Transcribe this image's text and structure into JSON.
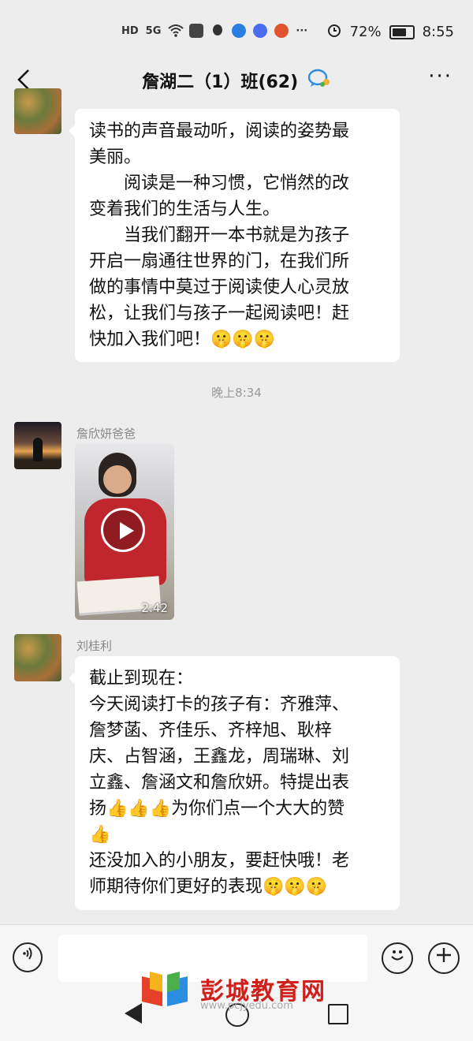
{
  "status_bar": {
    "left_icons": [
      "hd-icon",
      "signal-5g-icon",
      "wifi-icon",
      "app-icon",
      "qq-icon",
      "browser-icon",
      "music-icon",
      "news-icon",
      "more-dots-icon"
    ],
    "hd": "HD",
    "net": "5G",
    "overflow": "···",
    "battery_percent": "72%",
    "battery_level": 0.72,
    "time": "8:55"
  },
  "header": {
    "back": "‹",
    "title": "詹湖二（1）班(62)",
    "more": "···"
  },
  "messages": [
    {
      "lines": [
        "读书的声音最动听，阅读的姿势最",
        "美丽。",
        "　　阅读是一种习惯，它悄然的改",
        "变着我们的生活与人生。",
        "　　当我们翻开一本书就是为孩子",
        "开启一扇通往世界的门，在我们所",
        "做的事情中莫过于阅读使人心灵放",
        "松，让我们与孩子一起阅读吧！赶",
        "快加入我们吧！🤫🤫🤫"
      ]
    },
    {
      "timestamp": "晚上8:34"
    },
    {
      "sender": "詹欣妍爸爸",
      "video_duration": "2:42"
    },
    {
      "sender": "刘桂利",
      "lines": [
        "截止到现在：",
        "今天阅读打卡的孩子有：齐雅萍、",
        "詹梦菡、齐佳乐、齐梓旭、耿梓",
        "庆、占智涵，王鑫龙，周瑞琳、刘",
        "立鑫、詹涵文和詹欣妍。特提出表",
        "扬👍👍👍为你们点一个大大的赞",
        "👍",
        "还没加入的小朋友，要赶快哦！老",
        "师期待你们更好的表现🤫🤫🤫"
      ]
    }
  ],
  "input_bar": {
    "voice": "🔊",
    "placeholder": "",
    "emoji": "☺",
    "plus": "+"
  },
  "watermark": {
    "text": "彭城教育网",
    "url": "www.pcjyedu.com"
  },
  "colors": {
    "background": "#ededed",
    "bubble": "#ffffff",
    "watermark_red": "#d0201c"
  }
}
